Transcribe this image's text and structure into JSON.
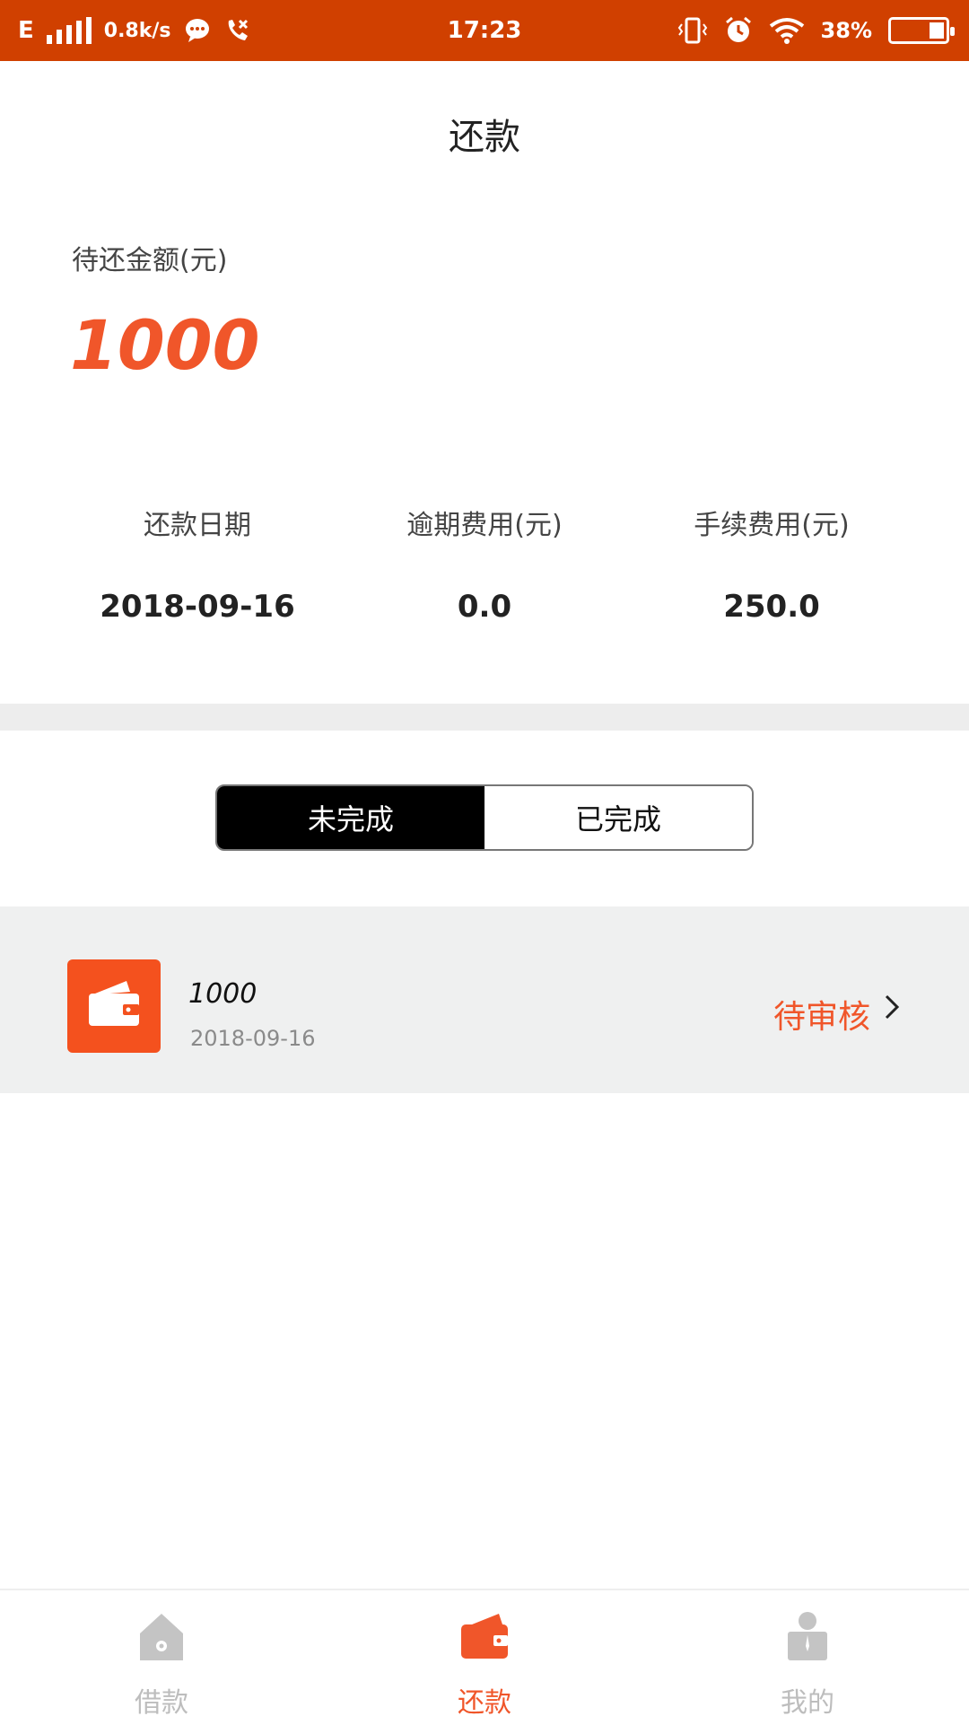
{
  "status_bar": {
    "network": "E",
    "speed": "0.8k/s",
    "time": "17:23",
    "battery": "38%"
  },
  "header": {
    "title": "还款"
  },
  "summary": {
    "due_label": "待还金额(元)",
    "due_amount": "1000",
    "metrics": [
      {
        "label": "还款日期",
        "value": "2018-09-16"
      },
      {
        "label": "逾期费用(元)",
        "value": "0.0"
      },
      {
        "label": "手续费用(元)",
        "value": "250.0"
      }
    ]
  },
  "tabs": {
    "incomplete": "未完成",
    "complete": "已完成",
    "selected": "未完成"
  },
  "list": {
    "items": [
      {
        "amount": "1000",
        "date": "2018-09-16",
        "status": "待审核",
        "icon": "wallet-icon"
      }
    ]
  },
  "bottom_nav": {
    "items": [
      {
        "label": "借款",
        "icon": "home-icon",
        "active": false
      },
      {
        "label": "还款",
        "icon": "wallet-icon",
        "active": true
      },
      {
        "label": "我的",
        "icon": "profile-icon",
        "active": false
      }
    ]
  },
  "colors": {
    "status_bar": "#D04000",
    "accent": "#F0562A",
    "icon_bg": "#F4511E",
    "list_bg": "#EFF0F0",
    "divider": "#EDEDED",
    "inactive_nav": "#BDBDBD"
  }
}
